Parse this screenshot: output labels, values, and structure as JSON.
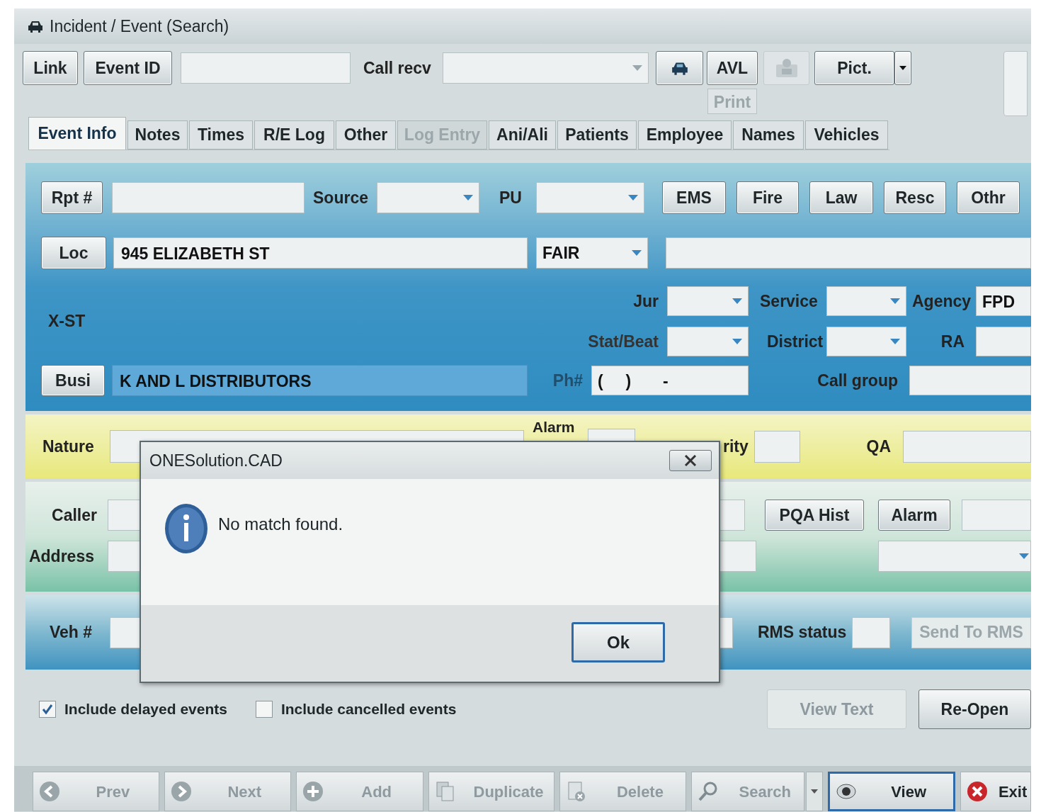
{
  "window": {
    "title": "Incident / Event (Search)"
  },
  "toolbar": {
    "link": "Link",
    "event_id": "Event ID",
    "call_recv_label": "Call recv",
    "avl": "AVL",
    "print": {
      "label": "Print",
      "disabled": true
    },
    "pict": "Pict."
  },
  "tabs": [
    {
      "label": "Event Info",
      "selected": true,
      "disabled": false
    },
    {
      "label": "Notes",
      "selected": false,
      "disabled": false
    },
    {
      "label": "Times",
      "selected": false,
      "disabled": false
    },
    {
      "label": "R/E Log",
      "selected": false,
      "disabled": false
    },
    {
      "label": "Other",
      "selected": false,
      "disabled": false
    },
    {
      "label": "Log Entry",
      "selected": false,
      "disabled": true
    },
    {
      "label": "Ani/Ali",
      "selected": false,
      "disabled": false
    },
    {
      "label": "Patients",
      "selected": false,
      "disabled": false
    },
    {
      "label": "Employee",
      "selected": false,
      "disabled": false
    },
    {
      "label": "Names",
      "selected": false,
      "disabled": false
    },
    {
      "label": "Vehicles",
      "selected": false,
      "disabled": false
    }
  ],
  "location": {
    "rpt_button": "Rpt #",
    "source_label": "Source",
    "pu_label": "PU",
    "service_buttons": [
      "EMS",
      "Fire",
      "Law",
      "Resc",
      "Othr"
    ],
    "loc_button": "Loc",
    "loc_value": "945 ELIZABETH ST",
    "city_value": "FAIR",
    "xst_label": "X-ST",
    "jur_label": "Jur",
    "service_label": "Service",
    "agency_label": "Agency",
    "agency_value": "FPD",
    "stat_beat_label": "Stat/Beat",
    "district_label": "District",
    "ra_label": "RA",
    "busi_button": "Busi",
    "busi_value": "K AND L DISTRIBUTORS",
    "phone_label": "Ph#",
    "phone_value": "(     )       -",
    "call_group_label": "Call group"
  },
  "nature": {
    "label": "Nature",
    "alarm_label": "Alarm",
    "priority_label": "rity",
    "qa_label": "QA"
  },
  "caller": {
    "caller_label": "Caller",
    "address_label": "Address",
    "pqa_hist": "PQA Hist",
    "alarm": "Alarm"
  },
  "vehicle": {
    "veh_label": "Veh #",
    "rms_status_label": "RMS status",
    "send_to_rms": {
      "label": "Send To RMS",
      "disabled": true
    }
  },
  "options": [
    {
      "label": "Include delayed events",
      "checked": true
    },
    {
      "label": "Include cancelled events",
      "checked": false
    }
  ],
  "actions": [
    {
      "label": "View Text",
      "disabled": true
    },
    {
      "label": "Re-Open",
      "disabled": false
    }
  ],
  "nav_buttons": [
    {
      "label": "Prev",
      "kind": "prev",
      "disabled": true,
      "focused": false
    },
    {
      "label": "Next",
      "kind": "next",
      "disabled": true,
      "focused": false
    },
    {
      "label": "Add",
      "kind": "add",
      "disabled": true,
      "focused": false
    },
    {
      "label": "Duplicate",
      "kind": "duplicate",
      "disabled": true,
      "focused": false
    },
    {
      "label": "Delete",
      "kind": "delete",
      "disabled": true,
      "focused": false
    },
    {
      "label": "Search",
      "kind": "search",
      "disabled": true,
      "focused": false
    },
    {
      "label": "View",
      "kind": "view",
      "disabled": false,
      "focused": true
    },
    {
      "label": "Exit",
      "kind": "exit",
      "disabled": false,
      "focused": false
    }
  ],
  "dialog": {
    "title": "ONESolution.CAD",
    "message": "No match found.",
    "button": "Ok"
  }
}
